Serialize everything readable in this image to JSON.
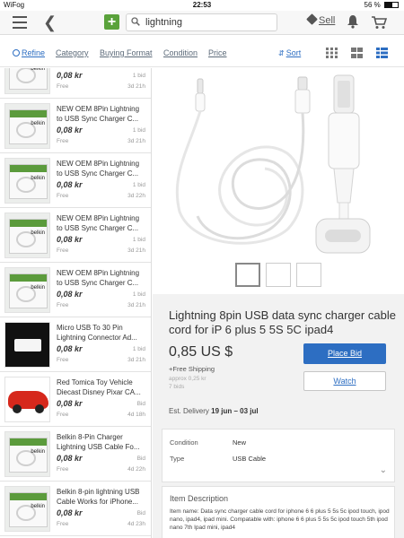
{
  "status": {
    "carrier": "WiFog",
    "time": "22:53",
    "battery": "56 %",
    "battery_level": 0.56
  },
  "topnav": {
    "search_value": "lightning",
    "sell_label": "Sell"
  },
  "filters": {
    "refine": "Refine",
    "category": "Category",
    "buying_format": "Buying Format",
    "condition": "Condition",
    "price": "Price",
    "sort": "Sort"
  },
  "results": [
    {
      "title": "",
      "price": "0,08 kr",
      "ship": "Free",
      "bids": "1 bid",
      "time_left": "3d 21h",
      "thumb": "belkin"
    },
    {
      "title": "NEW OEM 8Pin Lightning to USB Sync Charger C...",
      "price": "0,08 kr",
      "ship": "Free",
      "bids": "1 bid",
      "time_left": "3d 21h",
      "thumb": "belkin"
    },
    {
      "title": "NEW OEM 8Pin Lightning to USB Sync Charger C...",
      "price": "0,08 kr",
      "ship": "Free",
      "bids": "1 bid",
      "time_left": "3d 22h",
      "thumb": "belkin"
    },
    {
      "title": "NEW OEM 8Pin Lightning to USB Sync Charger C...",
      "price": "0,08 kr",
      "ship": "Free",
      "bids": "1 bid",
      "time_left": "3d 21h",
      "thumb": "belkin"
    },
    {
      "title": "NEW OEM 8Pin Lightning to USB Sync Charger C...",
      "price": "0,08 kr",
      "ship": "Free",
      "bids": "1 bid",
      "time_left": "3d 21h",
      "thumb": "belkin"
    },
    {
      "title": "Micro USB To 30 Pin Lightning Connector Ad...",
      "price": "0,08 kr",
      "ship": "Free",
      "bids": "1 bid",
      "time_left": "3d 21h",
      "thumb": "dark"
    },
    {
      "title": "Red Tomica Toy Vehicle Diecast Disney Pixar CA...",
      "price": "0,08 kr",
      "ship": "Free",
      "bids": "Bid",
      "time_left": "4d 18h",
      "thumb": "car"
    },
    {
      "title": "Belkin 8-Pin Charger Lightning USB Cable Fo...",
      "price": "0,08 kr",
      "ship": "Free",
      "bids": "Bid",
      "time_left": "4d 22h",
      "thumb": "belkin"
    },
    {
      "title": "Belkin 8-pin lightning USB Cable Works for iPhone...",
      "price": "0,08 kr",
      "ship": "Free",
      "bids": "Bid",
      "time_left": "4d 23h",
      "thumb": "belkin"
    }
  ],
  "detail": {
    "title": "Lightning 8pin USB data sync charger cable cord for iP 6 plus 5 5S 5C ipad4",
    "price": "0,85 US $",
    "shipping": "+Free Shipping",
    "approx": "approx 0,25 kr",
    "bids": "7 bids",
    "place_bid": "Place Bid",
    "watch": "Watch",
    "est_label": "Est. Delivery",
    "est_value": "19 jun – 03 jul",
    "condition_label": "Condition",
    "condition_value": "New",
    "type_label": "Type",
    "type_value": "USB Cable",
    "desc_heading": "Item Description",
    "desc_text": "Item name:  Data sync charger cable cord for iphone 6 6 plus 5 5s 5c ipod touch, ipod nano, ipad4, ipad mini. Compatable with: iphone 6 6 plus 5 5s 5c ipod touch 5th ipod nano 7th Ipad mini, ipad4"
  }
}
